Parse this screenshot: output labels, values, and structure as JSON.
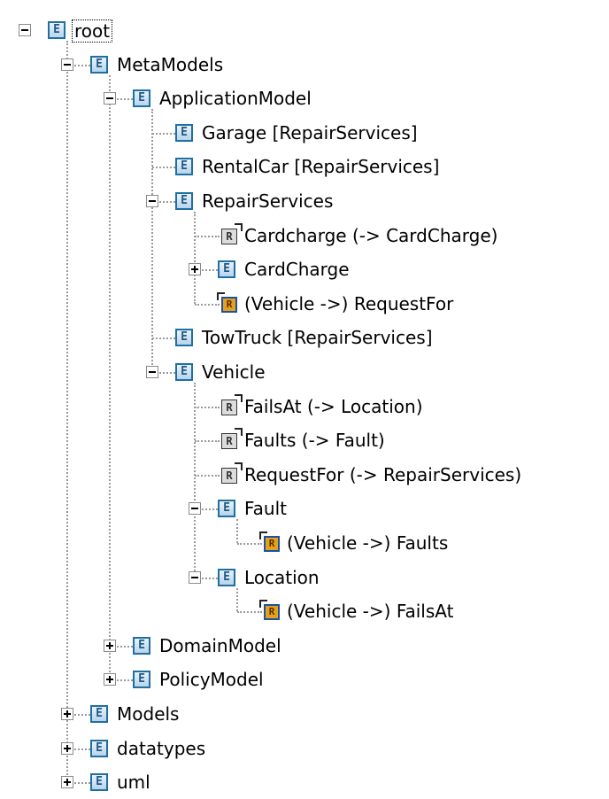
{
  "tree": {
    "nodes": [
      {
        "label": "root",
        "icon": "element-icon",
        "icon_letter": "E",
        "toggle": "expanded",
        "selected": true
      },
      {
        "label": "MetaModels",
        "icon": "element-icon",
        "icon_letter": "E",
        "toggle": "expanded"
      },
      {
        "label": "ApplicationModel",
        "icon": "element-icon",
        "icon_letter": "E",
        "toggle": "expanded"
      },
      {
        "label": "Garage [RepairServices]",
        "icon": "element-icon",
        "icon_letter": "E",
        "toggle": "none"
      },
      {
        "label": "RentalCar [RepairServices]",
        "icon": "element-icon",
        "icon_letter": "E",
        "toggle": "none"
      },
      {
        "label": "RepairServices",
        "icon": "element-icon",
        "icon_letter": "E",
        "toggle": "expanded"
      },
      {
        "label": "Cardcharge (-> CardCharge)",
        "icon": "reference-icon",
        "icon_letter": "R",
        "toggle": "none"
      },
      {
        "label": "CardCharge",
        "icon": "element-icon",
        "icon_letter": "E",
        "toggle": "collapsed"
      },
      {
        "label": "(Vehicle ->) RequestFor",
        "icon": "opposite-reference-icon",
        "icon_letter": "R",
        "toggle": "none"
      },
      {
        "label": "TowTruck [RepairServices]",
        "icon": "element-icon",
        "icon_letter": "E",
        "toggle": "none"
      },
      {
        "label": "Vehicle",
        "icon": "element-icon",
        "icon_letter": "E",
        "toggle": "expanded"
      },
      {
        "label": "FailsAt (-> Location)",
        "icon": "reference-icon",
        "icon_letter": "R",
        "toggle": "none"
      },
      {
        "label": "Faults (-> Fault)",
        "icon": "reference-icon",
        "icon_letter": "R",
        "toggle": "none"
      },
      {
        "label": "RequestFor (-> RepairServices)",
        "icon": "reference-icon",
        "icon_letter": "R",
        "toggle": "none"
      },
      {
        "label": "Fault",
        "icon": "element-icon",
        "icon_letter": "E",
        "toggle": "expanded"
      },
      {
        "label": "(Vehicle ->) Faults",
        "icon": "opposite-reference-icon",
        "icon_letter": "R",
        "toggle": "none"
      },
      {
        "label": "Location",
        "icon": "element-icon",
        "icon_letter": "E",
        "toggle": "expanded"
      },
      {
        "label": "(Vehicle ->) FailsAt",
        "icon": "opposite-reference-icon",
        "icon_letter": "R",
        "toggle": "none"
      },
      {
        "label": "DomainModel",
        "icon": "element-icon",
        "icon_letter": "E",
        "toggle": "collapsed"
      },
      {
        "label": "PolicyModel",
        "icon": "element-icon",
        "icon_letter": "E",
        "toggle": "collapsed"
      },
      {
        "label": "Models",
        "icon": "element-icon",
        "icon_letter": "E",
        "toggle": "collapsed"
      },
      {
        "label": "datatypes",
        "icon": "element-icon",
        "icon_letter": "E",
        "toggle": "collapsed"
      },
      {
        "label": "uml",
        "icon": "element-icon",
        "icon_letter": "E",
        "toggle": "collapsed"
      }
    ]
  },
  "colors": {
    "element_border": "#1f6fa0",
    "element_fill": "#b9d4ec",
    "reference_fill": "#dcdcdc",
    "opposite_reference_fill": "#e4a21a",
    "connector_line": "#9a9a9a"
  }
}
